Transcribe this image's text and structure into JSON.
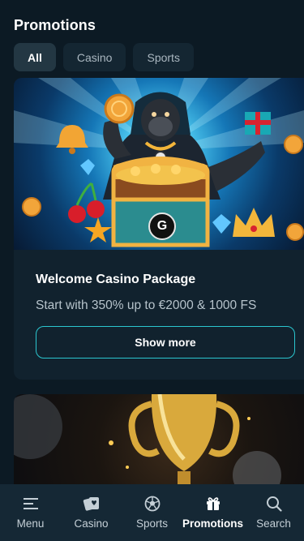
{
  "page": {
    "title": "Promotions"
  },
  "filters": [
    {
      "label": "All",
      "active": true
    },
    {
      "label": "Casino",
      "active": false
    },
    {
      "label": "Sports",
      "active": false
    }
  ],
  "promo_card": {
    "title": "Welcome Casino Package",
    "subtitle": "Start with 350% up to €2000 & 1000 FS",
    "button_label": "Show more",
    "badge_letter": "G"
  },
  "bottom_nav": [
    {
      "label": "Menu",
      "icon": "menu-icon"
    },
    {
      "label": "Casino",
      "icon": "casino-cards-icon"
    },
    {
      "label": "Sports",
      "icon": "soccer-ball-icon"
    },
    {
      "label": "Promotions",
      "icon": "gift-icon",
      "active": true
    },
    {
      "label": "Search",
      "icon": "search-icon"
    }
  ],
  "colors": {
    "background": "#0c1a24",
    "card": "#11222e",
    "accent_border": "#2bc6cf",
    "nav_bg": "#152835"
  }
}
